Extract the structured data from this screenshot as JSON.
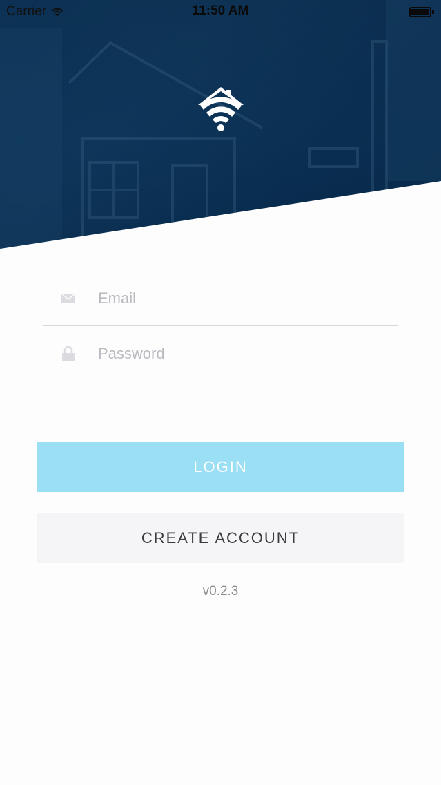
{
  "status_bar": {
    "carrier": "Carrier",
    "time": "11:50 AM",
    "wifi_icon": "wifi-icon",
    "battery_icon": "battery-icon"
  },
  "hero": {
    "logo_icon": "wifi-house-logo-icon",
    "colors": {
      "overlay": "#0d3b63"
    }
  },
  "form": {
    "email": {
      "placeholder": "Email",
      "value": "",
      "icon": "envelope-icon"
    },
    "password": {
      "placeholder": "Password",
      "value": "",
      "icon": "lock-icon"
    }
  },
  "buttons": {
    "login_label": "LOGIN",
    "create_account_label": "CREATE ACCOUNT"
  },
  "footer": {
    "version": "v0.2.3"
  },
  "colors": {
    "login_button": "#9bdff5",
    "create_button": "#f5f4f7",
    "divider": "#d9d6df"
  }
}
